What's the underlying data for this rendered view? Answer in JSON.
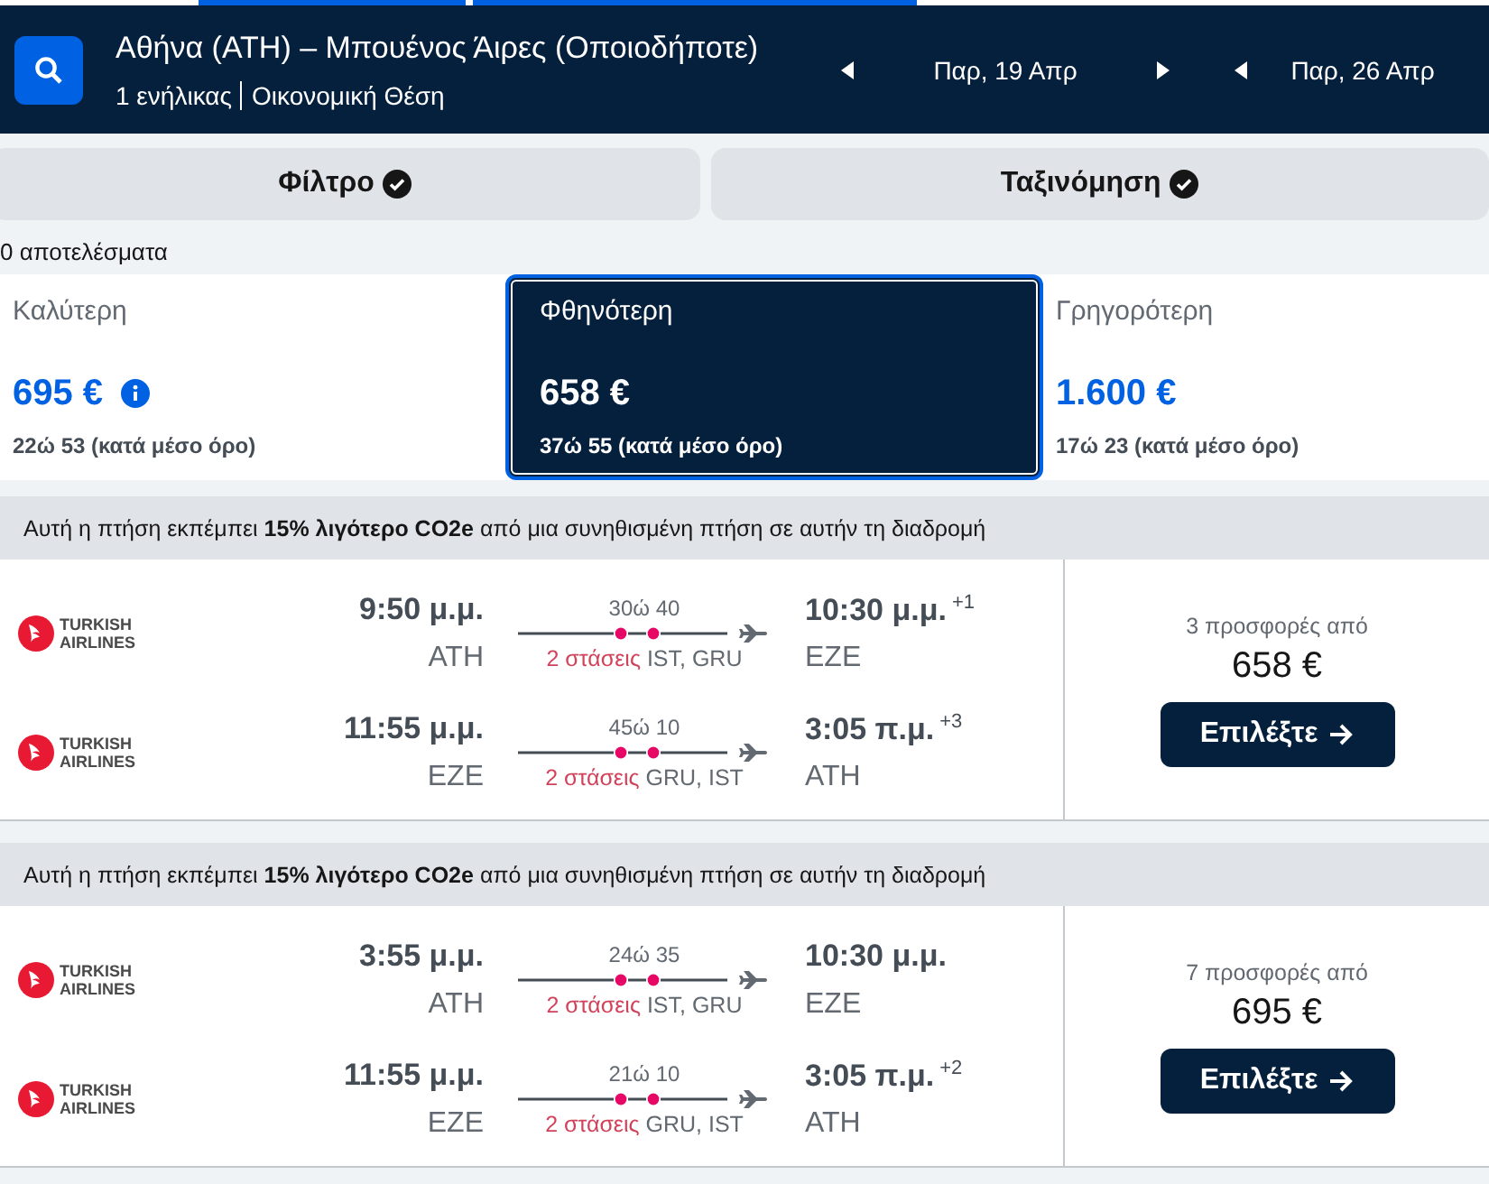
{
  "header": {
    "route": "Αθήνα (ATH) – Μπουένος Άιρες (Οποιοδήποτε)",
    "travellers": "1 ενήλικας",
    "cabin": "Οικονομική Θέση",
    "dates": [
      {
        "label": "Παρ, 19 Απρ"
      },
      {
        "label": "Παρ, 26 Απρ"
      }
    ]
  },
  "toolbar": [
    {
      "label": "Φίλτρο",
      "checked": true
    },
    {
      "label": "Ταξινόμηση",
      "checked": true
    }
  ],
  "results_count": "0 αποτελέσματα",
  "sort_tabs": [
    {
      "label": "Καλύτερη",
      "price": "695 €",
      "info": true,
      "duration": "22ώ 53 (κατά μέσο όρο)",
      "selected": false
    },
    {
      "label": "Φθηνότερη",
      "price": "658 €",
      "info": false,
      "duration": "37ώ 55 (κατά μέσο όρο)",
      "selected": true
    },
    {
      "label": "Γρηγορότερη",
      "price": "1.600 €",
      "info": false,
      "duration": "17ώ 23 (κατά μέσο όρο)",
      "selected": false
    }
  ],
  "results": [
    {
      "eco_note": "Αυτή η πτήση εκπέμπει **15% λιγότερο CO2e** από μια συνηθισμένη πτήση σε αυτήν τη διαδρομή",
      "offers": "3 προσφορές από",
      "price": "658 €",
      "button": "Επιλέξτε",
      "legs": [
        {
          "airline": "TURKISH AIRLINES",
          "depart": "9:50 μ.μ.",
          "from": "ATH",
          "duration": "30ώ 40",
          "stops": "2 στάσεις",
          "via": "IST, GRU",
          "arrive": "10:30 μ.μ.",
          "day_offset": "+1",
          "to": "EZE"
        },
        {
          "airline": "TURKISH AIRLINES",
          "depart": "11:55 μ.μ.",
          "from": "EZE",
          "duration": "45ώ 10",
          "stops": "2 στάσεις",
          "via": "GRU, IST",
          "arrive": "3:05 π.μ.",
          "day_offset": "+3",
          "to": "ATH"
        }
      ]
    },
    {
      "eco_note": "Αυτή η πτήση εκπέμπει **15% λιγότερο CO2e** από μια συνηθισμένη πτήση σε αυτήν τη διαδρομή",
      "offers": "7 προσφορές από",
      "price": "695 €",
      "button": "Επιλέξτε",
      "legs": [
        {
          "airline": "TURKISH AIRLINES",
          "depart": "3:55 μ.μ.",
          "from": "ATH",
          "duration": "24ώ 35",
          "stops": "2 στάσεις",
          "via": "IST, GRU",
          "arrive": "10:30 μ.μ.",
          "to": "EZE"
        },
        {
          "airline": "TURKISH AIRLINES",
          "depart": "11:55 μ.μ.",
          "from": "EZE",
          "duration": "21ώ 10",
          "stops": "2 στάσεις",
          "via": "GRU, IST",
          "arrive": "3:05 π.μ.",
          "day_offset": "+2",
          "to": "ATH"
        }
      ]
    }
  ]
}
